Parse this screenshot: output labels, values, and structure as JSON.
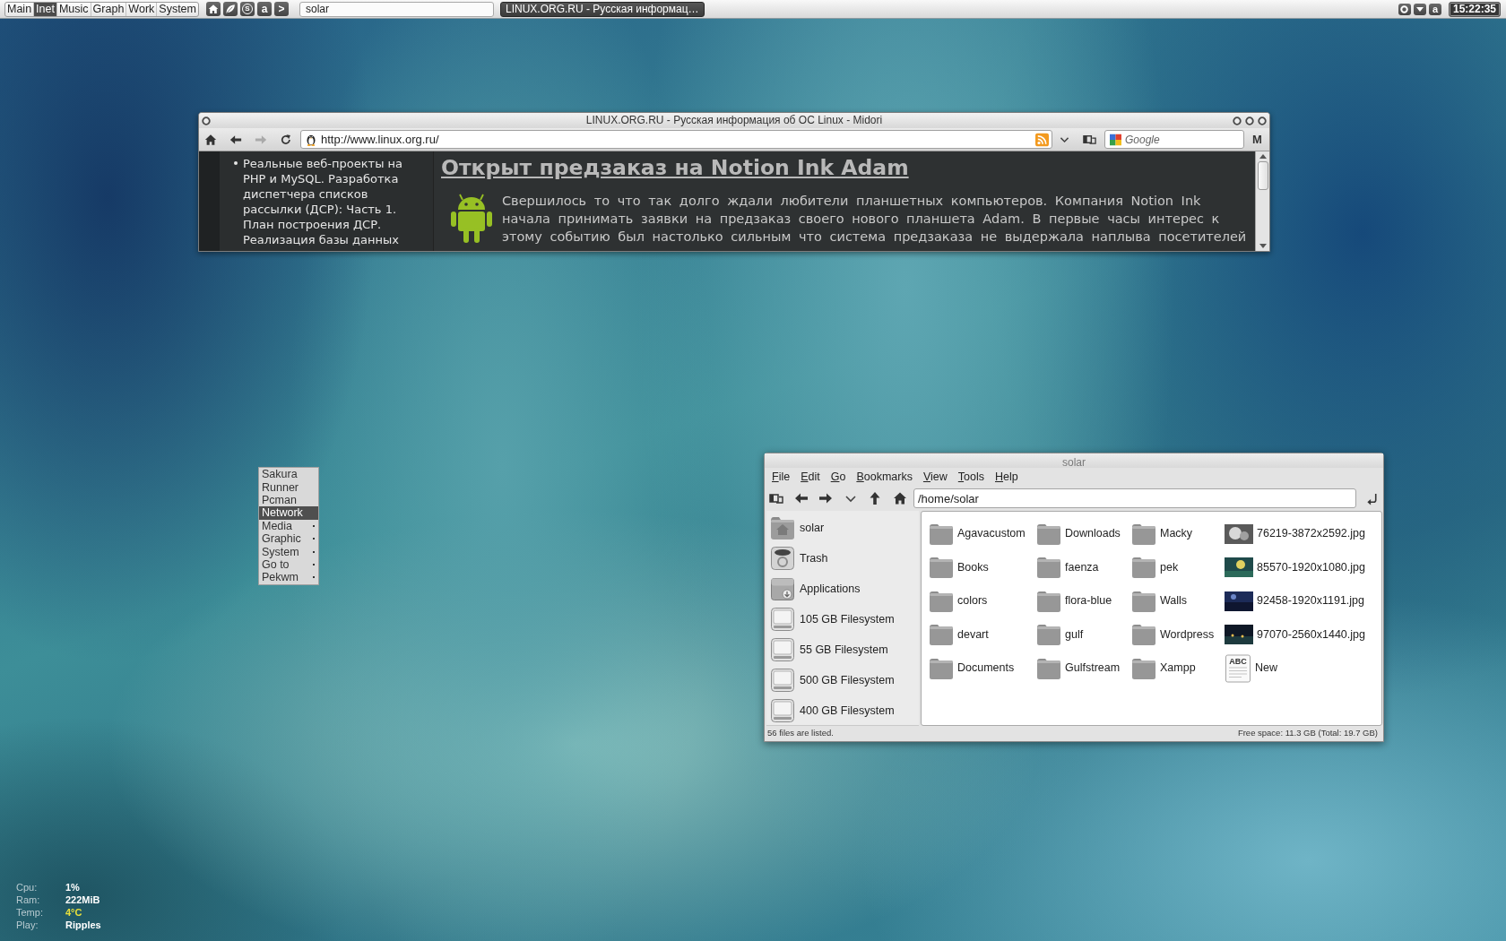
{
  "top_panel": {
    "workspaces": [
      {
        "label": "Main",
        "selected": false
      },
      {
        "label": "Inet",
        "selected": true
      },
      {
        "label": "Music",
        "selected": false
      },
      {
        "label": "Graph",
        "selected": false
      },
      {
        "label": "Work",
        "selected": false
      },
      {
        "label": "System",
        "selected": false
      }
    ],
    "launchers": [
      {
        "kind": "home"
      },
      {
        "kind": "leaf"
      },
      {
        "kind": "ring_letter",
        "glyph": "S"
      },
      {
        "kind": "letter",
        "glyph": "a"
      },
      {
        "kind": "letter",
        "glyph": ">"
      }
    ],
    "search": {
      "value": "solar"
    },
    "task": {
      "label": "LINUX.ORG.RU - Русская информац…"
    },
    "tray": [
      {
        "kind": "ring"
      },
      {
        "kind": "triangle_down"
      },
      {
        "kind": "letter",
        "glyph": "a"
      }
    ],
    "clock": "15:22:35"
  },
  "browser_window": {
    "title": "LINUX.ORG.RU - Русская информация об ОС Linux - Midori",
    "nav_buttons": [
      {
        "kind": "home",
        "disabled": false
      },
      {
        "kind": "back",
        "disabled": false
      },
      {
        "kind": "forward",
        "disabled": true
      },
      {
        "kind": "reload",
        "disabled": false
      }
    ],
    "address": "http://www.linux.org.ru/",
    "search": {
      "placeholder": "Google"
    },
    "menu_button": "M",
    "sidebar_links": [
      "Реальные веб-проекты на PHP и MySQL. Разработка диспетчера списков рассылки (ДСР): Часть 1. План построения ДСР. Реализация базы данных"
    ],
    "article": {
      "title": "Открыт предзаказ на Notion Ink Adam",
      "text": "Свершилось то что так долго ждали любители планшетных компьютеров. Компания Notion Ink начала принимать заявки на предзаказ своего нового планшета Adam. В первые часы интерес к этому событию был настолько сильным что система предзаказа не выдержала наплыва посетителей"
    }
  },
  "desktop_menu": {
    "items": [
      {
        "label": "Sakura",
        "selected": false,
        "submenu": false
      },
      {
        "label": "Runner",
        "selected": false,
        "submenu": false
      },
      {
        "label": "Pcman",
        "selected": false,
        "submenu": false
      },
      {
        "label": "Network",
        "selected": true,
        "submenu": false
      },
      {
        "label": "Media",
        "selected": false,
        "submenu": true
      },
      {
        "label": "Graphic",
        "selected": false,
        "submenu": true
      },
      {
        "label": "System",
        "selected": false,
        "submenu": true
      },
      {
        "label": "Go to",
        "selected": false,
        "submenu": true
      },
      {
        "label": "Pekwm",
        "selected": false,
        "submenu": true
      }
    ]
  },
  "file_manager": {
    "title": "solar",
    "menu": [
      "File",
      "Edit",
      "Go",
      "Bookmarks",
      "View",
      "Tools",
      "Help"
    ],
    "toolbar": [
      {
        "kind": "panel"
      },
      {
        "kind": "back"
      },
      {
        "kind": "forward"
      },
      {
        "kind": "history"
      },
      {
        "kind": "up"
      },
      {
        "kind": "home"
      }
    ],
    "location": "/home/solar",
    "places": [
      {
        "kind": "home",
        "label": "solar"
      },
      {
        "kind": "trash",
        "label": "Trash"
      },
      {
        "kind": "applications",
        "label": "Applications"
      },
      {
        "kind": "drive",
        "label": "105 GB Filesystem"
      },
      {
        "kind": "drive",
        "label": "55 GB Filesystem"
      },
      {
        "kind": "drive",
        "label": "500 GB Filesystem"
      },
      {
        "kind": "drive",
        "label": "400 GB Filesystem"
      }
    ],
    "files": [
      {
        "kind": "folder",
        "name": "Agavacustom"
      },
      {
        "kind": "folder",
        "name": "Books"
      },
      {
        "kind": "folder",
        "name": "colors"
      },
      {
        "kind": "folder",
        "name": "devart"
      },
      {
        "kind": "folder",
        "name": "Documents"
      },
      {
        "kind": "folder",
        "name": "Downloads"
      },
      {
        "kind": "folder",
        "name": "faenza"
      },
      {
        "kind": "folder",
        "name": "flora-blue"
      },
      {
        "kind": "folder",
        "name": "gulf"
      },
      {
        "kind": "folder",
        "name": "Gulfstream"
      },
      {
        "kind": "folder",
        "name": "Macky"
      },
      {
        "kind": "folder",
        "name": "pek"
      },
      {
        "kind": "folder",
        "name": "Walls"
      },
      {
        "kind": "folder",
        "name": "Wordpress"
      },
      {
        "kind": "folder",
        "name": "Xampp"
      },
      {
        "kind": "image",
        "name": "76219-3872x2592.jpg"
      },
      {
        "kind": "image",
        "name": "85570-1920x1080.jpg"
      },
      {
        "kind": "image",
        "name": "92458-1920x1191.jpg"
      },
      {
        "kind": "image",
        "name": "97070-2560x1440.jpg"
      },
      {
        "kind": "document",
        "name": "New",
        "icon_text": "ABC"
      }
    ],
    "status": {
      "left": "56 files are listed.",
      "right": "Free space: 11.3 GB (Total: 19.7 GB)"
    }
  },
  "system_monitor": [
    {
      "label": "Cpu:",
      "value": "1%",
      "color": "#ffffff"
    },
    {
      "label": "Ram:",
      "value": "222MiB",
      "color": "#ffffff"
    },
    {
      "label": "Temp:",
      "value": "4°C",
      "color": "#e8e03c"
    },
    {
      "label": "Play:",
      "value": "Ripples",
      "color": "#ffffff"
    }
  ]
}
